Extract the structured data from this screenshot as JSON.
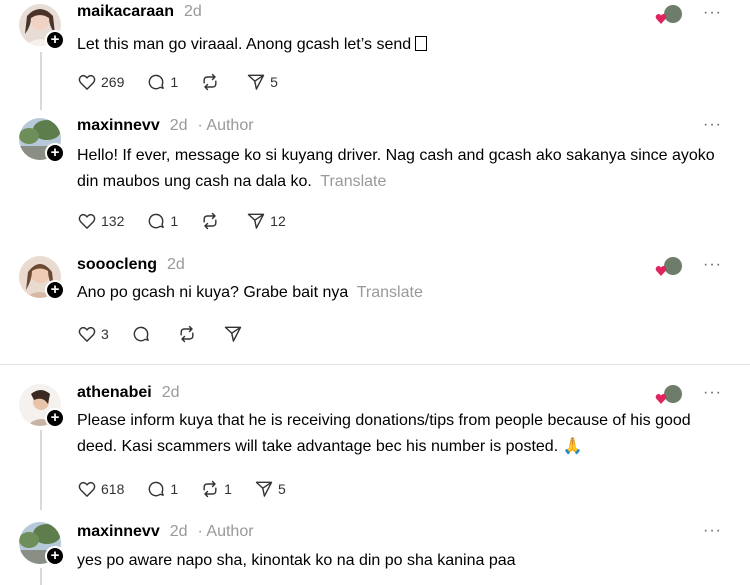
{
  "comments": [
    {
      "username": "maikacaraan",
      "time": "2d",
      "author_badge": "",
      "text": "Let this man go viraaal. Anong gcash let’s send",
      "translate": "",
      "likes": "269",
      "replies": "1",
      "reposts": "",
      "shares": "5"
    },
    {
      "username": "maxinnevv",
      "time": "2d",
      "author_badge": "· Author",
      "text": "Hello! If ever, message ko si kuyang driver. Nag cash and gcash ako sakanya since ayoko din maubos ung cash na dala ko.",
      "translate": "Translate",
      "likes": "132",
      "replies": "1",
      "reposts": "",
      "shares": "12"
    },
    {
      "username": "sooocleng",
      "time": "2d",
      "author_badge": "",
      "text": "Ano po gcash ni kuya? Grabe bait nya",
      "translate": "Translate",
      "likes": "3",
      "replies": "",
      "reposts": "",
      "shares": ""
    },
    {
      "username": "athenabei",
      "time": "2d",
      "author_badge": "",
      "text": "Please inform kuya that he is receiving donations/tips from people because of his good deed. Kasi scammers will take advantage bec his number is posted. 🙏",
      "translate": "",
      "likes": "618",
      "replies": "1",
      "reposts": "1",
      "shares": "5"
    },
    {
      "username": "maxinnevv",
      "time": "2d",
      "author_badge": "· Author",
      "text": "yes po aware napo sha, kinontak ko na din po sha kanina paa",
      "translate": "",
      "likes": "",
      "replies": "",
      "reposts": "",
      "shares": ""
    }
  ],
  "more_label": "···",
  "colors": {
    "muted": "#999999",
    "divider": "#e3e3e3",
    "heart_red": "#e0245e"
  },
  "icons": [
    "heart-icon",
    "comment-icon",
    "repost-icon",
    "share-icon",
    "more-icon",
    "liked-by-author-icon",
    "follow-plus-icon"
  ]
}
